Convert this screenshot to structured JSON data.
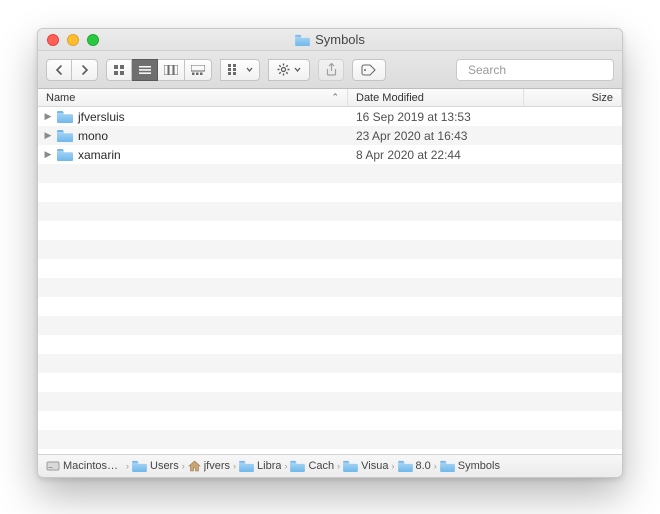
{
  "window": {
    "title": "Symbols"
  },
  "toolbar": {
    "nav": {
      "back_tip": "Back",
      "forward_tip": "Forward"
    },
    "search_placeholder": "Search"
  },
  "columns": {
    "name": "Name",
    "date_modified": "Date Modified",
    "size": "Size"
  },
  "rows": [
    {
      "name": "jfversluis",
      "date": "16 Sep 2019 at 13:53"
    },
    {
      "name": "mono",
      "date": "23 Apr 2020 at 16:43"
    },
    {
      "name": "xamarin",
      "date": "8 Apr 2020 at 22:44"
    }
  ],
  "path": [
    {
      "kind": "disk",
      "label": "Macintosh HD"
    },
    {
      "kind": "folder",
      "label": "Users"
    },
    {
      "kind": "home",
      "label": "jfvers"
    },
    {
      "kind": "folder",
      "label": "Libra"
    },
    {
      "kind": "folder",
      "label": "Cach"
    },
    {
      "kind": "folder",
      "label": "Visua"
    },
    {
      "kind": "folder",
      "label": "8.0"
    },
    {
      "kind": "folder",
      "label": "Symbols"
    }
  ],
  "colors": {
    "folder_light": "#A7D3F4",
    "folder_dark": "#6FB8EB"
  }
}
